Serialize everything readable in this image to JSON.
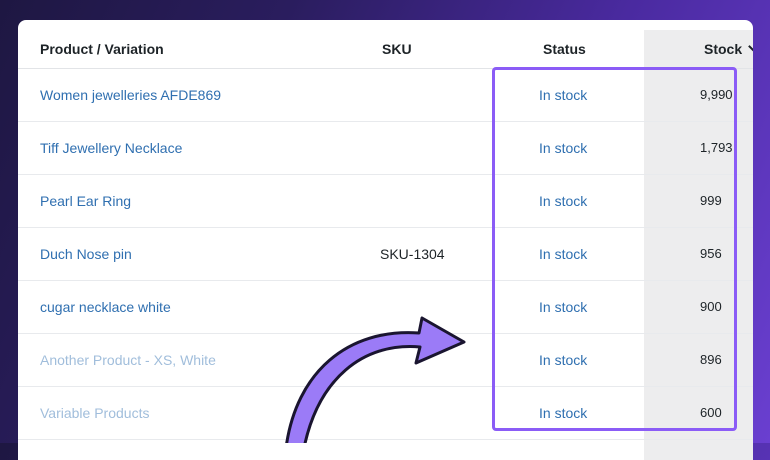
{
  "table": {
    "headers": {
      "product": "Product / Variation",
      "sku": "SKU",
      "status": "Status",
      "stock": "Stock"
    },
    "sort_icon": "chevron-down-icon",
    "rows": [
      {
        "product": "Women jewelleries AFDE869",
        "sku": "",
        "status": "In stock",
        "stock": "9,990"
      },
      {
        "product": "Tiff Jewellery Necklace",
        "sku": "",
        "status": "In stock",
        "stock": "1,793"
      },
      {
        "product": "Pearl Ear Ring",
        "sku": "",
        "status": "In stock",
        "stock": "999"
      },
      {
        "product": "Duch Nose pin",
        "sku": "SKU-1304",
        "status": "In stock",
        "stock": "956"
      },
      {
        "product": "cugar necklace white",
        "sku": "",
        "status": "In stock",
        "stock": "900"
      },
      {
        "product": "Another Product - XS, White",
        "sku": "",
        "status": "In stock",
        "stock": "896"
      },
      {
        "product": "Variable Products",
        "sku": "",
        "status": "In stock",
        "stock": "600"
      }
    ]
  },
  "colors": {
    "link": "#2f6fb0",
    "highlight": "#8b5cf6",
    "arrow_fill": "#9b7bf7",
    "arrow_stroke": "#1a1530"
  }
}
